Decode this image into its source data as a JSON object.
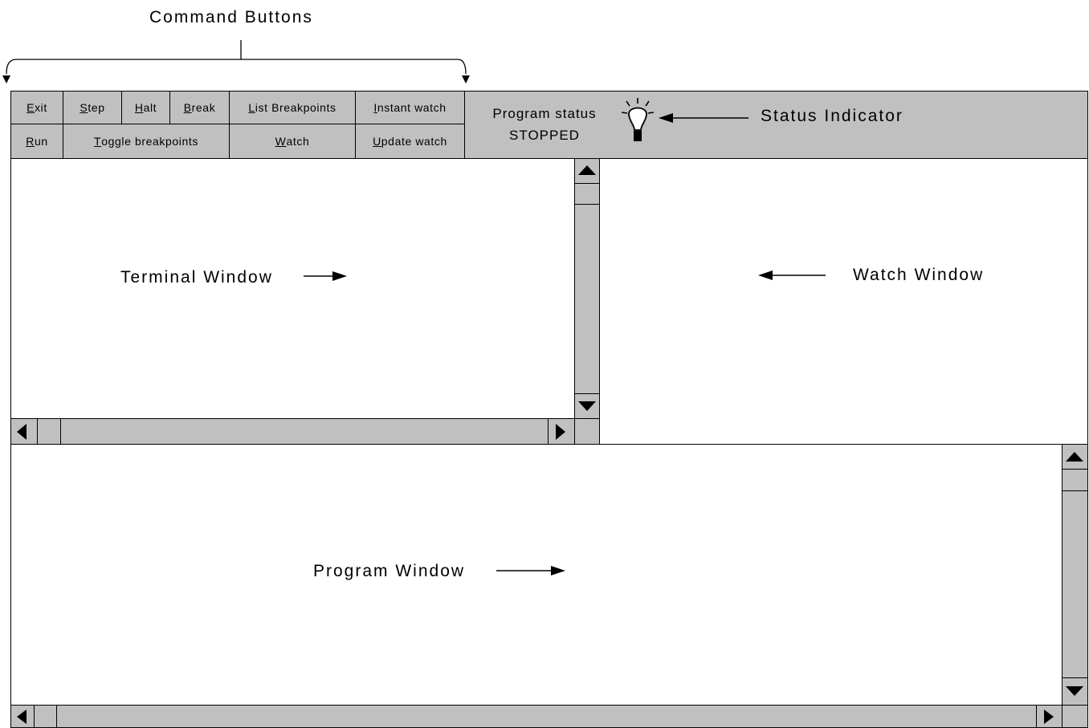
{
  "annotations": {
    "command_buttons": "Command Buttons",
    "status_indicator": "Status Indicator",
    "terminal_window": "Terminal Window",
    "watch_window": "Watch Window",
    "program_window": "Program Window"
  },
  "toolbar": {
    "row1": [
      {
        "key": "E",
        "rest": "xit"
      },
      {
        "key": "S",
        "rest": "tep"
      },
      {
        "key": "H",
        "rest": "alt"
      },
      {
        "key": "B",
        "rest": "reak"
      },
      {
        "key": "L",
        "rest": "ist Breakpoints"
      },
      {
        "key": "I",
        "rest": "nstant watch"
      }
    ],
    "row2": [
      {
        "key": "R",
        "rest": "un"
      },
      {
        "key": "T",
        "rest": "oggle breakpoints"
      },
      {
        "key": "W",
        "rest": "atch"
      },
      {
        "key": "U",
        "rest": "pdate watch"
      }
    ]
  },
  "status": {
    "label": "Program status",
    "value": "STOPPED",
    "icon": "lightbulb-icon"
  }
}
